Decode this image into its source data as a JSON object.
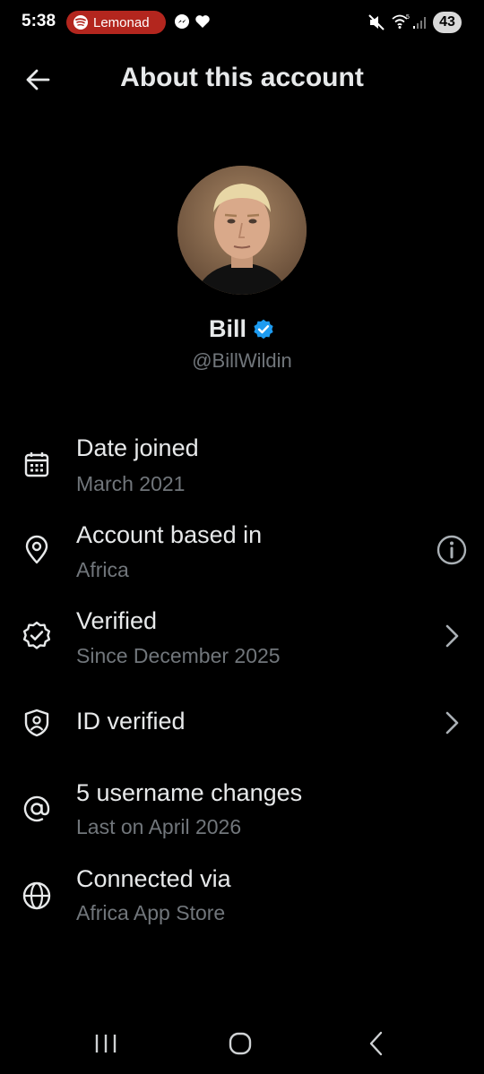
{
  "status_bar": {
    "time": "5:38",
    "media_app": "Lemonad",
    "battery": "43",
    "accent_red": "#b3261e"
  },
  "header": {
    "title": "About this account",
    "back_icon": "arrow-left-icon"
  },
  "profile": {
    "display_name": "Bill",
    "handle": "@BillWildin",
    "verified_color": "#1d9bf0"
  },
  "items": [
    {
      "icon": "calendar-icon",
      "title": "Date joined",
      "subtitle": "March 2021",
      "trailing": null
    },
    {
      "icon": "location-pin-icon",
      "title": "Account based in",
      "subtitle": "Africa",
      "trailing": "info-icon"
    },
    {
      "icon": "verified-badge-icon",
      "title": "Verified",
      "subtitle": "Since December 2025",
      "trailing": "chevron-right-icon"
    },
    {
      "icon": "id-shield-icon",
      "title": "ID verified",
      "subtitle": "",
      "trailing": "chevron-right-icon"
    },
    {
      "icon": "at-sign-icon",
      "title": "5 username changes",
      "subtitle": "Last on April 2026",
      "trailing": null
    },
    {
      "icon": "globe-icon",
      "title": "Connected via",
      "subtitle": "Africa App Store",
      "trailing": null
    }
  ],
  "nav_bar": [
    "recents-icon",
    "home-icon",
    "back-icon"
  ],
  "colors": {
    "background": "#000000",
    "primary_text": "#e7e9ea",
    "secondary_text": "#71767b"
  }
}
